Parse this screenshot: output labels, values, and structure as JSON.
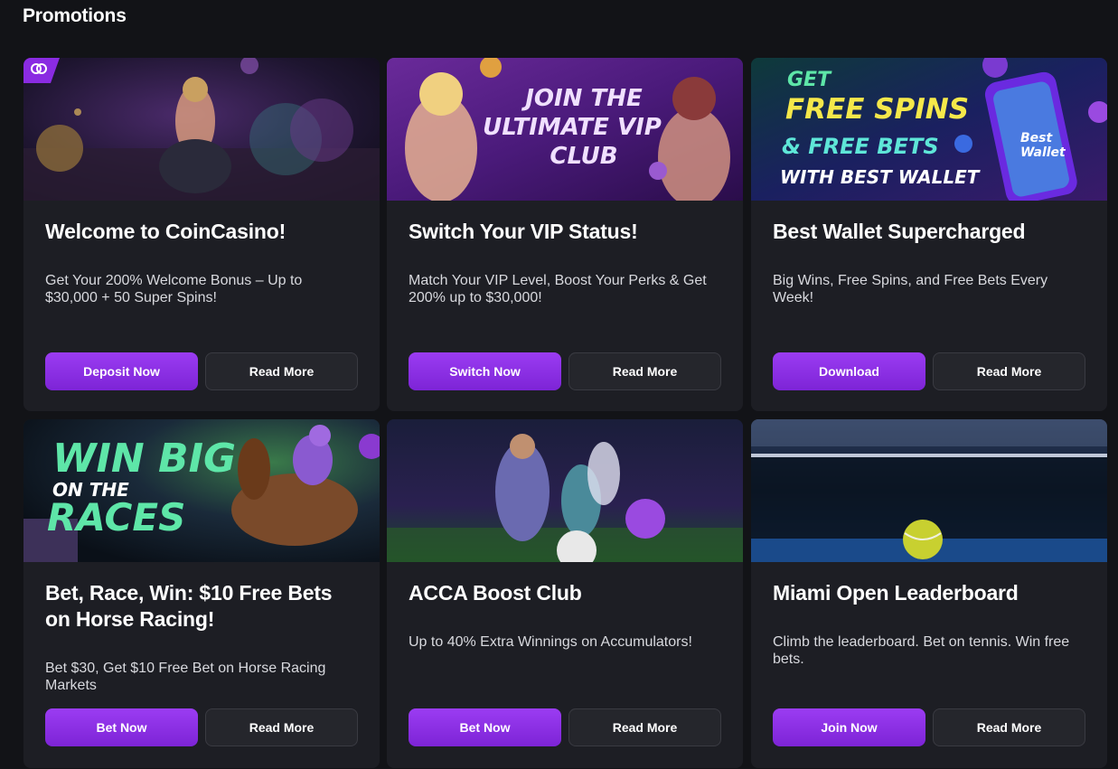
{
  "page": {
    "title": "Promotions"
  },
  "cards": [
    {
      "title": "Welcome to CoinCasino!",
      "description": "Get Your 200% Welcome Bonus – Up to $30,000 + 50 Super Spins!",
      "primary_label": "Deposit Now",
      "secondary_label": "Read More",
      "banner_lines": []
    },
    {
      "title": "Switch Your VIP Status!",
      "description": "Match Your VIP Level, Boost Your Perks & Get 200% up to $30,000!",
      "primary_label": "Switch Now",
      "secondary_label": "Read More",
      "banner_lines": [
        "JOIN THE",
        "ULTIMATE VIP",
        "CLUB"
      ]
    },
    {
      "title": "Best Wallet Supercharged",
      "description": "Big Wins, Free Spins, and Free Bets Every Week!",
      "primary_label": "Download",
      "secondary_label": "Read More",
      "banner_lines": [
        "GET",
        "FREE SPINS",
        "& FREE BETS",
        "WITH BEST WALLET",
        "Best",
        "Wallet"
      ]
    },
    {
      "title": "Bet, Race, Win: $10 Free Bets on Horse Racing!",
      "description": "Bet $30, Get $10 Free Bet on Horse Racing Markets",
      "primary_label": "Bet Now",
      "secondary_label": "Read More",
      "banner_lines": [
        "WIN BIG",
        "ON THE",
        "RACES"
      ]
    },
    {
      "title": "ACCA Boost Club",
      "description": "Up to 40% Extra Winnings on Accumulators!",
      "primary_label": "Bet Now",
      "secondary_label": "Read More",
      "banner_lines": []
    },
    {
      "title": "Miami Open Leaderboard",
      "description": "Climb the leaderboard. Bet on tennis. Win free bets.",
      "primary_label": "Join Now",
      "secondary_label": "Read More",
      "banner_lines": []
    }
  ],
  "colors": {
    "background": "#121317",
    "card": "#1d1e24",
    "primary_button": "#8a2be2",
    "secondary_button": "#25262c",
    "accent_yellow": "#f5e84a",
    "accent_green": "#5ee6a8"
  }
}
